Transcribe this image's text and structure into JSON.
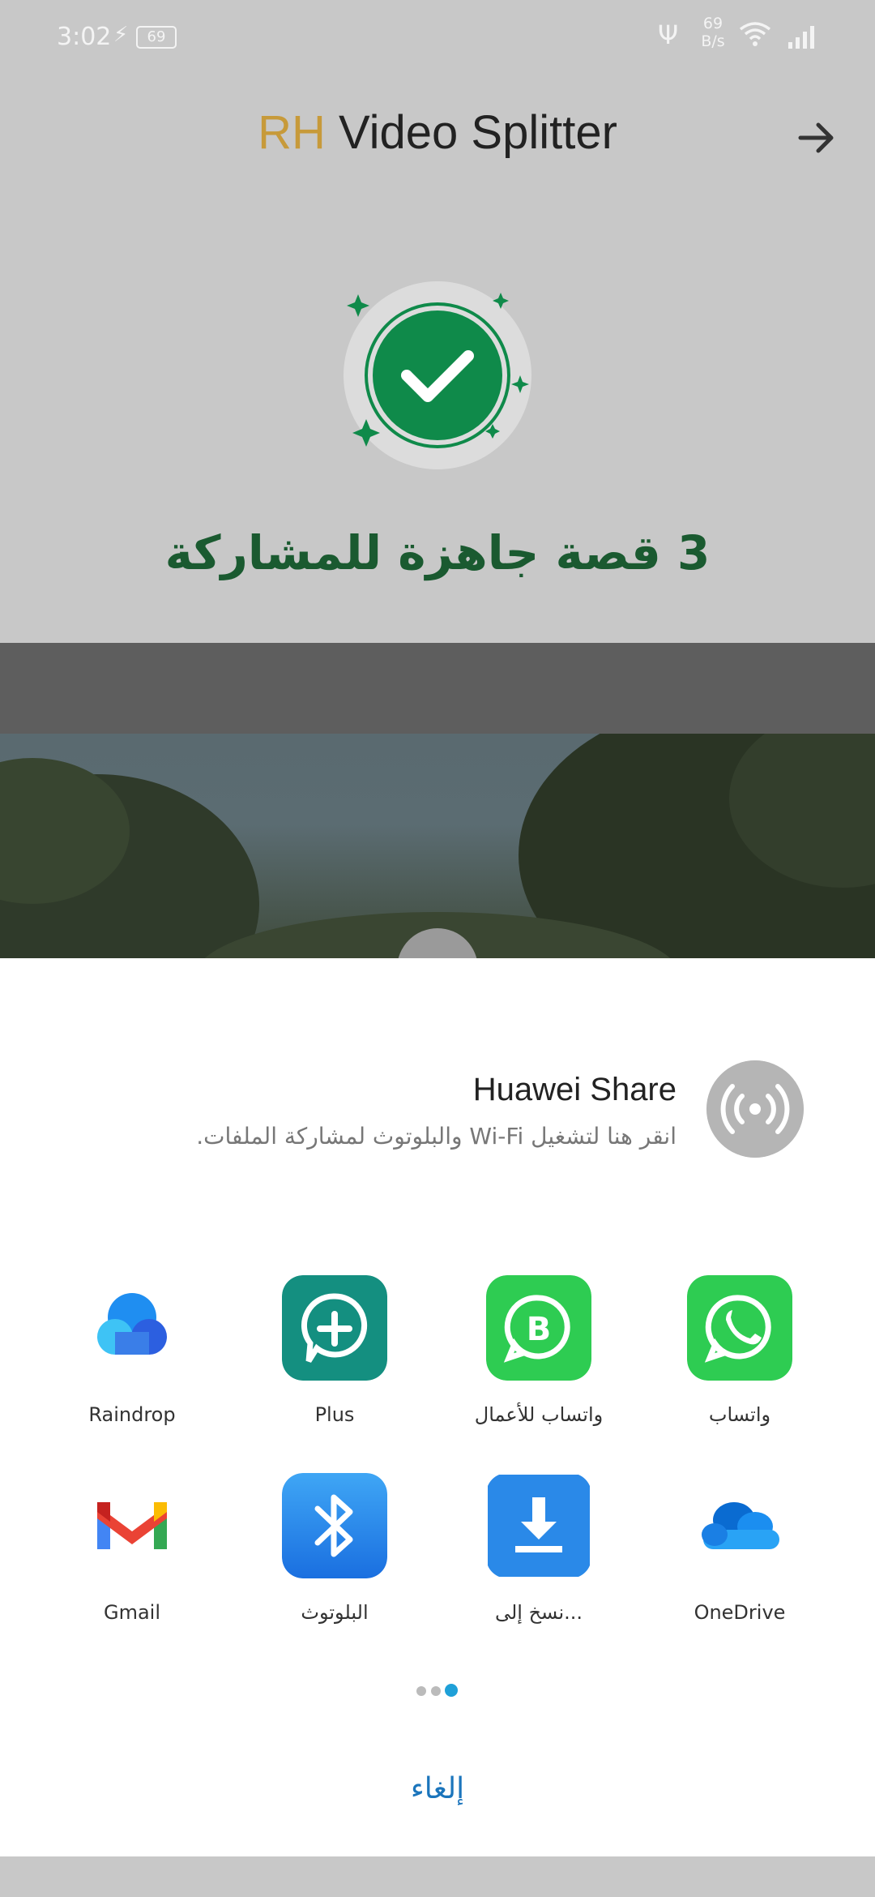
{
  "status_bar": {
    "time": "3:02",
    "battery": "69",
    "net_speed_value": "69",
    "net_speed_unit": "B/s",
    "icons": [
      "charging-icon",
      "usb-icon",
      "wifi-icon",
      "signal-icon"
    ]
  },
  "header": {
    "brand": "RH",
    "title_rest": " Video Splitter",
    "brand_color": "#c79a3a",
    "action_icon": "arrow-right-icon"
  },
  "success": {
    "icon": "check-circle-icon",
    "message": "3 قصة جاهزة للمشاركة",
    "message_color": "#1a5a30",
    "accent_color": "#0f8a4a"
  },
  "share_sheet": {
    "huawei_share": {
      "title": "Huawei Share",
      "subtitle": "انقر هنا لتشغيل Wi-Fi والبلوتوث لمشاركة الملفات.",
      "icon": "huawei-share-icon"
    },
    "apps": [
      {
        "label": "واتساب",
        "icon": "whatsapp-icon"
      },
      {
        "label": "واتساب للأعمال",
        "icon": "whatsapp-business-icon"
      },
      {
        "label": "Plus",
        "icon": "plus-messenger-icon"
      },
      {
        "label": "Raindrop",
        "icon": "raindrop-icon"
      },
      {
        "label": "OneDrive",
        "icon": "onedrive-icon"
      },
      {
        "label": "نسخ إلى...",
        "icon": "copy-to-icon"
      },
      {
        "label": "البلوتوث",
        "icon": "bluetooth-icon"
      },
      {
        "label": "Gmail",
        "icon": "gmail-icon"
      }
    ],
    "page_indicator": {
      "pages": 3,
      "active": 3
    },
    "cancel_label": "إلغاء"
  }
}
